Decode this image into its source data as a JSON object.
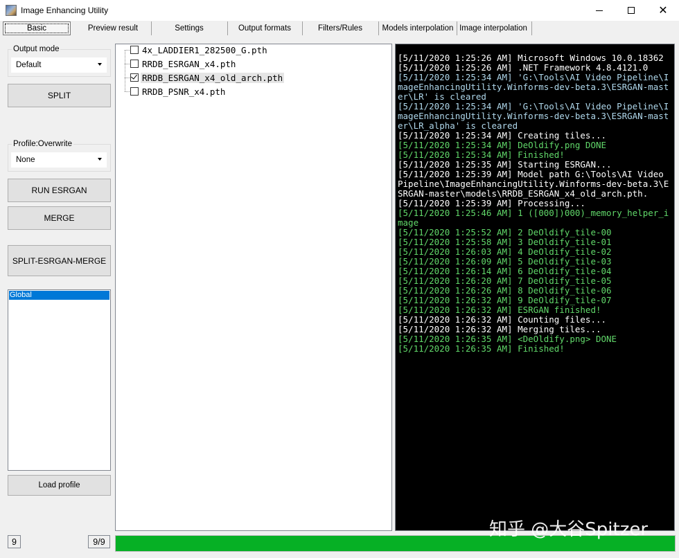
{
  "window": {
    "title": "Image Enhancing Utility"
  },
  "tabs": [
    {
      "label": "Basic"
    },
    {
      "label": "Preview result"
    },
    {
      "label": "Settings"
    },
    {
      "label": "Output formats"
    },
    {
      "label": "Filters/Rules"
    },
    {
      "label": "Models interpolation"
    },
    {
      "label": "Image interpolation"
    }
  ],
  "left": {
    "output_mode": {
      "label": "Output mode",
      "value": "Default"
    },
    "split_button": "SPLIT",
    "profile": {
      "label": "Profile:Overwrite",
      "value": "None"
    },
    "run_esrgan_button": "RUN ESRGAN",
    "merge_button": "MERGE",
    "split_esrgan_merge_button": "SPLIT-ESRGAN-MERGE",
    "profiles_list": [
      "Global"
    ],
    "load_profile_button": "Load profile"
  },
  "models": [
    {
      "name": "4x_LADDIER1_282500_G.pth",
      "checked": false
    },
    {
      "name": "RRDB_ESRGAN_x4.pth",
      "checked": false
    },
    {
      "name": "RRDB_ESRGAN_x4_old_arch.pth",
      "checked": true
    },
    {
      "name": "RRDB_PSNR_x4.pth",
      "checked": false
    }
  ],
  "console": [
    {
      "color": "white",
      "text": "[5/11/2020 1:25:26 AM] Microsoft Windows 10.0.18362"
    },
    {
      "color": "white",
      "text": "[5/11/2020 1:25:26 AM] .NET Framework 4.8.4121.0"
    },
    {
      "color": "cyan",
      "text": "[5/11/2020 1:25:34 AM] 'G:\\Tools\\AI Video Pipeline\\ImageEnhancingUtility.Winforms-dev-beta.3\\ESRGAN-master\\LR' is cleared"
    },
    {
      "color": "cyan",
      "text": "[5/11/2020 1:25:34 AM] 'G:\\Tools\\AI Video Pipeline\\ImageEnhancingUtility.Winforms-dev-beta.3\\ESRGAN-master\\LR_alpha' is cleared"
    },
    {
      "color": "white",
      "text": "[5/11/2020 1:25:34 AM] Creating tiles..."
    },
    {
      "color": "green",
      "text": "[5/11/2020 1:25:34 AM] DeOldify.png DONE"
    },
    {
      "color": "green",
      "text": "[5/11/2020 1:25:34 AM] Finished!"
    },
    {
      "color": "white",
      "text": "[5/11/2020 1:25:35 AM] Starting ESRGAN..."
    },
    {
      "color": "white",
      "text": "[5/11/2020 1:25:39 AM] Model path G:\\Tools\\AI Video Pipeline\\ImageEnhancingUtility.Winforms-dev-beta.3\\ESRGAN-master\\models\\RRDB_ESRGAN_x4_old_arch.pth."
    },
    {
      "color": "white",
      "text": "[5/11/2020 1:25:39 AM] Processing..."
    },
    {
      "color": "green",
      "text": "[5/11/2020 1:25:46 AM] 1 ([000])000)_memory_helper_image"
    },
    {
      "color": "green",
      "text": "[5/11/2020 1:25:52 AM] 2 DeOldify_tile-00"
    },
    {
      "color": "green",
      "text": "[5/11/2020 1:25:58 AM] 3 DeOldify_tile-01"
    },
    {
      "color": "green",
      "text": "[5/11/2020 1:26:03 AM] 4 DeOldify_tile-02"
    },
    {
      "color": "green",
      "text": "[5/11/2020 1:26:09 AM] 5 DeOldify_tile-03"
    },
    {
      "color": "green",
      "text": "[5/11/2020 1:26:14 AM] 6 DeOldify_tile-04"
    },
    {
      "color": "green",
      "text": "[5/11/2020 1:26:20 AM] 7 DeOldify_tile-05"
    },
    {
      "color": "green",
      "text": "[5/11/2020 1:26:26 AM] 8 DeOldify_tile-06"
    },
    {
      "color": "green",
      "text": "[5/11/2020 1:26:32 AM] 9 DeOldify_tile-07"
    },
    {
      "color": "green",
      "text": "[5/11/2020 1:26:32 AM] ESRGAN finished!"
    },
    {
      "color": "white",
      "text": "[5/11/2020 1:26:32 AM] Counting files..."
    },
    {
      "color": "white",
      "text": "[5/11/2020 1:26:32 AM] Merging tiles..."
    },
    {
      "color": "green",
      "text": "[5/11/2020 1:26:35 AM] <DeOldify.png> DONE"
    },
    {
      "color": "green",
      "text": "[5/11/2020 1:26:35 AM] Finished!"
    }
  ],
  "status": {
    "left_count": "9",
    "progress_text": "9/9",
    "progress_fraction": 1.0
  },
  "watermark": "知乎 @大谷Spitzer",
  "colors": {
    "progress": "#06b025",
    "console_bg": "#000000",
    "console_white": "#ffffff",
    "console_cyan": "#b0d8ec",
    "console_green": "#61d86a",
    "selection": "#0078d7"
  },
  "icons": {
    "app": "app-icon",
    "minimize": "minimize-icon",
    "maximize": "maximize-icon",
    "close": "close-icon",
    "dropdown": "chevron-down-icon"
  }
}
